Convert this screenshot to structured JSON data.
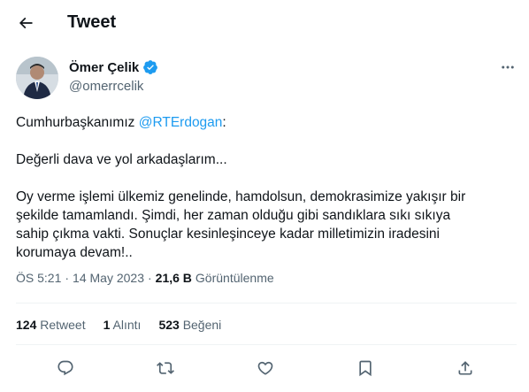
{
  "header": {
    "title": "Tweet",
    "back_icon": "arrow-left-icon"
  },
  "author": {
    "name": "Ömer Çelik",
    "handle": "@omerrcelik",
    "verified": true,
    "verified_color": "#1d9bf0"
  },
  "tweet": {
    "line1_prefix": "Cumhurbaşkanımız ",
    "line1_mention": "@RTErdogan",
    "line1_suffix": ":",
    "line2": "Değerli dava ve yol arkadaşlarım...",
    "line3": "Oy verme işlemi ülkemiz genelinde, hamdolsun, demokrasimize yakışır bir",
    "line4": "şekilde tamamlandı. Şimdi, her zaman olduğu gibi sandıklara sıkı sıkıya",
    "line5": "sahip çıkma vakti. Sonuçlar kesinleşinceye kadar milletimizin iradesini",
    "line6": "korumaya devam!.."
  },
  "meta": {
    "time": "ÖS 5:21",
    "separator": "·",
    "date": "14 May 2023",
    "separator2": "·",
    "views_count": "21,6 B",
    "views_label": "Görüntülenme"
  },
  "stats": {
    "retweets_count": "124",
    "retweets_label": "Retweet",
    "quotes_count": "1",
    "quotes_label": "Alıntı",
    "likes_count": "523",
    "likes_label": "Beğeni"
  },
  "actions": {
    "icons": [
      "reply-icon",
      "retweet-icon",
      "like-icon",
      "bookmark-icon",
      "share-icon"
    ]
  },
  "colors": {
    "accent": "#1d9bf0",
    "text_primary": "#0f1419",
    "text_secondary": "#536471",
    "divider": "#eff3f4"
  }
}
